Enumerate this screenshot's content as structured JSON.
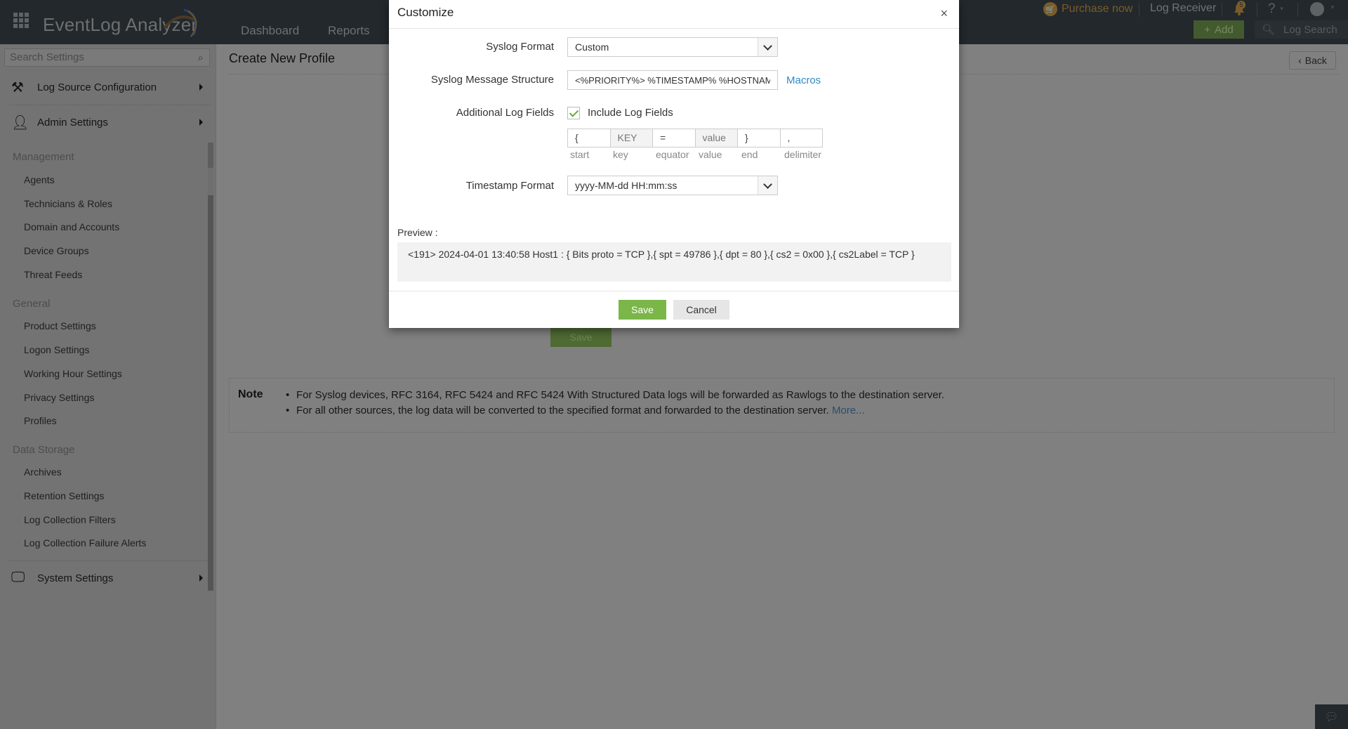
{
  "header": {
    "app_name": "EventLog Analyzer",
    "nav": [
      "Dashboard",
      "Reports"
    ],
    "purchase_label": "Purchase now",
    "log_receiver_label": "Log Receiver",
    "notification_count": "5",
    "help_label": "?",
    "add_label": "Add",
    "log_search_label": "Log Search",
    "icons": {
      "apps": "grid-icon",
      "cart": "cart-icon",
      "bell": "bell-icon",
      "user": "user-icon",
      "search": "search-icon"
    }
  },
  "sidebar": {
    "search_placeholder": "Search Settings",
    "sections": [
      {
        "label": "Log Source Configuration",
        "icon": "tools-icon"
      },
      {
        "label": "Admin Settings",
        "icon": "admin-user-gear-icon"
      },
      {
        "label": "System Settings",
        "icon": "monitor-gear-icon"
      }
    ],
    "groups": [
      {
        "title": "Management",
        "items": [
          "Agents",
          "Technicians & Roles",
          "Domain and Accounts",
          "Device Groups",
          "Threat Feeds"
        ]
      },
      {
        "title": "General",
        "items": [
          "Product Settings",
          "Logon Settings",
          "Working Hour Settings",
          "Privacy Settings",
          "Profiles"
        ]
      },
      {
        "title": "Data Storage",
        "items": [
          "Archives",
          "Retention Settings",
          "Log Collection Filters",
          "Log Collection Failure Alerts"
        ]
      }
    ]
  },
  "main": {
    "page_title": "Create New Profile",
    "back_label": "Back",
    "save_label": "Save",
    "note": {
      "label": "Note",
      "items": [
        "For Syslog devices, RFC 3164, RFC 5424 and RFC 5424 With Structured Data logs will be forwarded as Rawlogs to the destination server.",
        "For all other sources, the log data will be converted to the specified format and forwarded to the destination server."
      ],
      "more_link": "More..."
    }
  },
  "modal": {
    "title": "Customize",
    "close_label": "×",
    "syslog_format": {
      "label": "Syslog Format",
      "value": "Custom"
    },
    "message_structure": {
      "label": "Syslog Message Structure",
      "value": "<%PRIORITY%> %TIMESTAMP% %HOSTNAME%",
      "link": "Macros"
    },
    "additional_fields": {
      "label": "Additional Log Fields",
      "checkbox_label": "Include Log Fields",
      "checked": true,
      "cells": [
        {
          "value": "{",
          "caption": "start",
          "readonly": false
        },
        {
          "value": "KEY",
          "caption": "key",
          "readonly": true
        },
        {
          "value": "=",
          "caption": "equator",
          "readonly": false
        },
        {
          "value": "value",
          "caption": "value",
          "readonly": true
        },
        {
          "value": "}",
          "caption": "end",
          "readonly": false
        },
        {
          "value": ",",
          "caption": "delimiter",
          "readonly": false
        }
      ]
    },
    "timestamp_format": {
      "label": "Timestamp Format",
      "value": "yyyy-MM-dd HH:mm:ss"
    },
    "preview": {
      "label": "Preview :",
      "text": "<191> 2024-04-01 13:40:58 Host1 : { Bits proto = TCP },{ spt = 49786 },{ dpt = 80 },{ cs2 = 0x00 },{ cs2Label = TCP }"
    },
    "save_label": "Save",
    "cancel_label": "Cancel"
  }
}
